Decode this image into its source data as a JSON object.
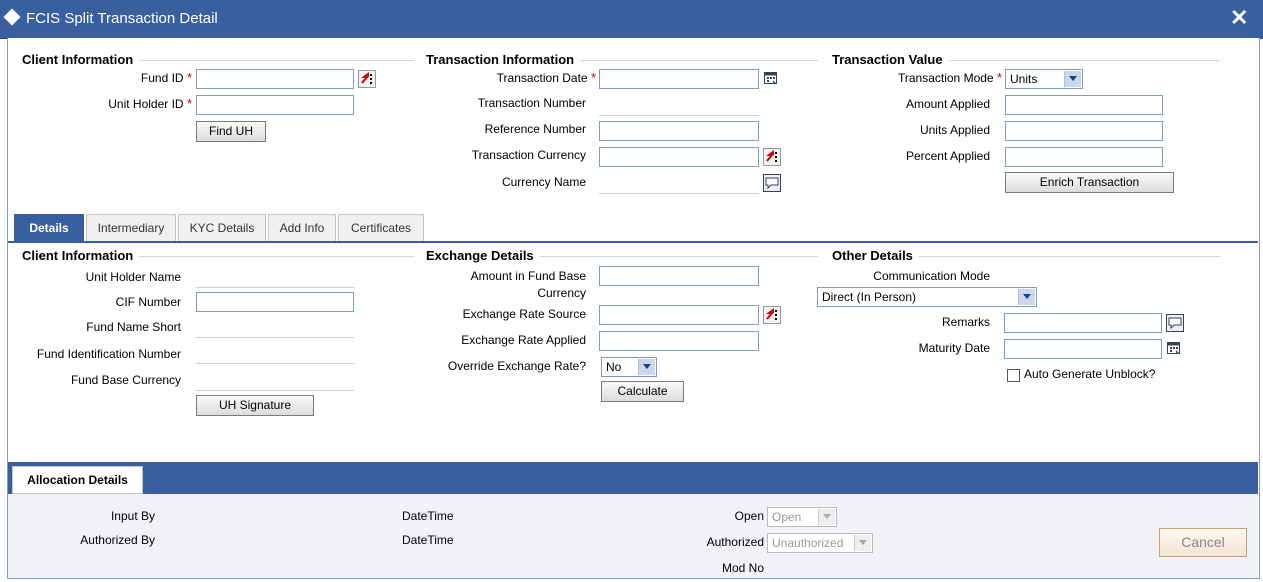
{
  "window": {
    "title": "FCIS Split Transaction Detail",
    "close_label": "✕"
  },
  "client_information": {
    "title": "Client Information",
    "fund_id_label": "Fund ID",
    "unit_holder_id_label": "Unit Holder ID",
    "required_mark": "*",
    "find_uh_button": "Find UH",
    "fund_id_value": "",
    "unit_holder_id_value": ""
  },
  "transaction_information": {
    "title": "Transaction Information",
    "transaction_date_label": "Transaction Date",
    "transaction_number_label": "Transaction Number",
    "reference_number_label": "Reference Number",
    "transaction_currency_label": "Transaction Currency",
    "currency_name_label": "Currency Name"
  },
  "transaction_value": {
    "title": "Transaction Value",
    "transaction_mode_label": "Transaction Mode",
    "transaction_mode_value": "Units",
    "amount_applied_label": "Amount Applied",
    "units_applied_label": "Units Applied",
    "percent_applied_label": "Percent Applied",
    "enrich_button": "Enrich Transaction"
  },
  "tabs": [
    {
      "label": "Details"
    },
    {
      "label": "Intermediary"
    },
    {
      "label": "KYC Details"
    },
    {
      "label": "Add Info"
    },
    {
      "label": "Certificates"
    }
  ],
  "details": {
    "client_information": {
      "title": "Client Information",
      "unit_holder_name_label": "Unit Holder Name",
      "cif_number_label": "CIF Number",
      "fund_name_short_label": "Fund Name Short",
      "fund_identification_number_label": "Fund Identification Number",
      "fund_base_currency_label": "Fund Base Currency",
      "uh_signature_button": "UH Signature"
    },
    "exchange_details": {
      "title": "Exchange Details",
      "amount_in_fund_base_label_1": "Amount in Fund Base",
      "amount_in_fund_base_label_2": "Currency",
      "exchange_rate_source_label": "Exchange Rate Source",
      "exchange_rate_applied_label": "Exchange Rate Applied",
      "override_exchange_rate_label": "Override Exchange Rate?",
      "override_value": "No",
      "calculate_button": "Calculate"
    },
    "other_details": {
      "title": "Other Details",
      "communication_mode_label": "Communication Mode",
      "communication_mode_value": "Direct (In Person)",
      "remarks_label": "Remarks",
      "maturity_date_label": "Maturity Date",
      "auto_generate_unblock_label": "Auto Generate Unblock?"
    }
  },
  "allocation": {
    "tab_label": "Allocation Details"
  },
  "footer": {
    "input_by_label": "Input By",
    "authorized_by_label": "Authorized By",
    "datetime_label_1": "DateTime",
    "datetime_label_2": "DateTime",
    "open_label": "Open",
    "open_value": "Open",
    "authorized_label": "Authorized",
    "authorized_value": "Unauthorized",
    "mod_no_label": "Mod No",
    "cancel_button": "Cancel"
  },
  "colors": {
    "header_blue": "#3a5f9e",
    "required_red": "#cc0000",
    "lov_arrow_red": "#cc0000"
  }
}
